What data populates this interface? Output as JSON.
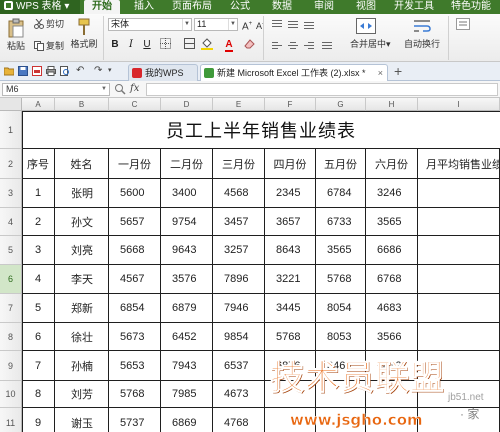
{
  "app": {
    "title": "WPS 表格"
  },
  "menu": {
    "tabs": [
      "开始",
      "插入",
      "页面布局",
      "公式",
      "数据",
      "审阅",
      "视图",
      "开发工具",
      "特色功能"
    ],
    "active": "开始"
  },
  "ribbon": {
    "paste": "粘贴",
    "cut": "剪切",
    "copy": "复制",
    "format_painter": "格式刷",
    "font_name": "宋体",
    "font_size": "11",
    "bold": "B",
    "italic": "I",
    "underline": "U",
    "merge_center": "合并居中",
    "wrap_text": "自动换行"
  },
  "doc_tabs": {
    "home": "我的WPS",
    "file": "新建 Microsoft Excel 工作表 (2).xlsx *",
    "add": "+"
  },
  "formula_bar": {
    "cell_ref": "M6",
    "fx": "fx",
    "value": ""
  },
  "sheet": {
    "column_headers": [
      "A",
      "B",
      "C",
      "D",
      "E",
      "F",
      "G",
      "H",
      "I"
    ],
    "row_headers": [
      "1",
      "2",
      "3",
      "4",
      "5",
      "6",
      "7",
      "8",
      "9",
      "10",
      "11"
    ],
    "selected_row": "6",
    "title": "员工上半年销售业绩表",
    "headers": [
      "序号",
      "姓名",
      "一月份",
      "二月份",
      "三月份",
      "四月份",
      "五月份",
      "六月份",
      "月平均销售业绩"
    ],
    "rows": [
      [
        "1",
        "张明",
        "5600",
        "3400",
        "4568",
        "2345",
        "6784",
        "3246",
        ""
      ],
      [
        "2",
        "孙文",
        "5657",
        "9754",
        "3457",
        "3657",
        "6733",
        "3565",
        ""
      ],
      [
        "3",
        "刘亮",
        "5668",
        "9643",
        "3257",
        "8643",
        "3565",
        "6686",
        ""
      ],
      [
        "4",
        "李天",
        "4567",
        "3576",
        "7896",
        "3221",
        "5768",
        "6768",
        ""
      ],
      [
        "5",
        "郑新",
        "6854",
        "6879",
        "7946",
        "3445",
        "8054",
        "4683",
        ""
      ],
      [
        "6",
        "徐壮",
        "5673",
        "6452",
        "9854",
        "5768",
        "8053",
        "3566",
        ""
      ],
      [
        "7",
        "孙楠",
        "5653",
        "7943",
        "6537",
        "6876",
        "3466",
        "7432",
        ""
      ],
      [
        "8",
        "刘芳",
        "5768",
        "7985",
        "4673",
        "",
        "",
        "",
        ""
      ],
      [
        "9",
        "谢玉",
        "5737",
        "6869",
        "4768",
        "",
        "",
        "",
        ""
      ]
    ]
  },
  "watermark": {
    "logo": "技术员联盟",
    "url": "www.jsgho.com",
    "site": "jb51.net",
    "site2": "· 家"
  },
  "colors": {
    "menubar": "#3f7a2b",
    "accent": "#2d6b1c",
    "watermark": "#e8660f"
  }
}
